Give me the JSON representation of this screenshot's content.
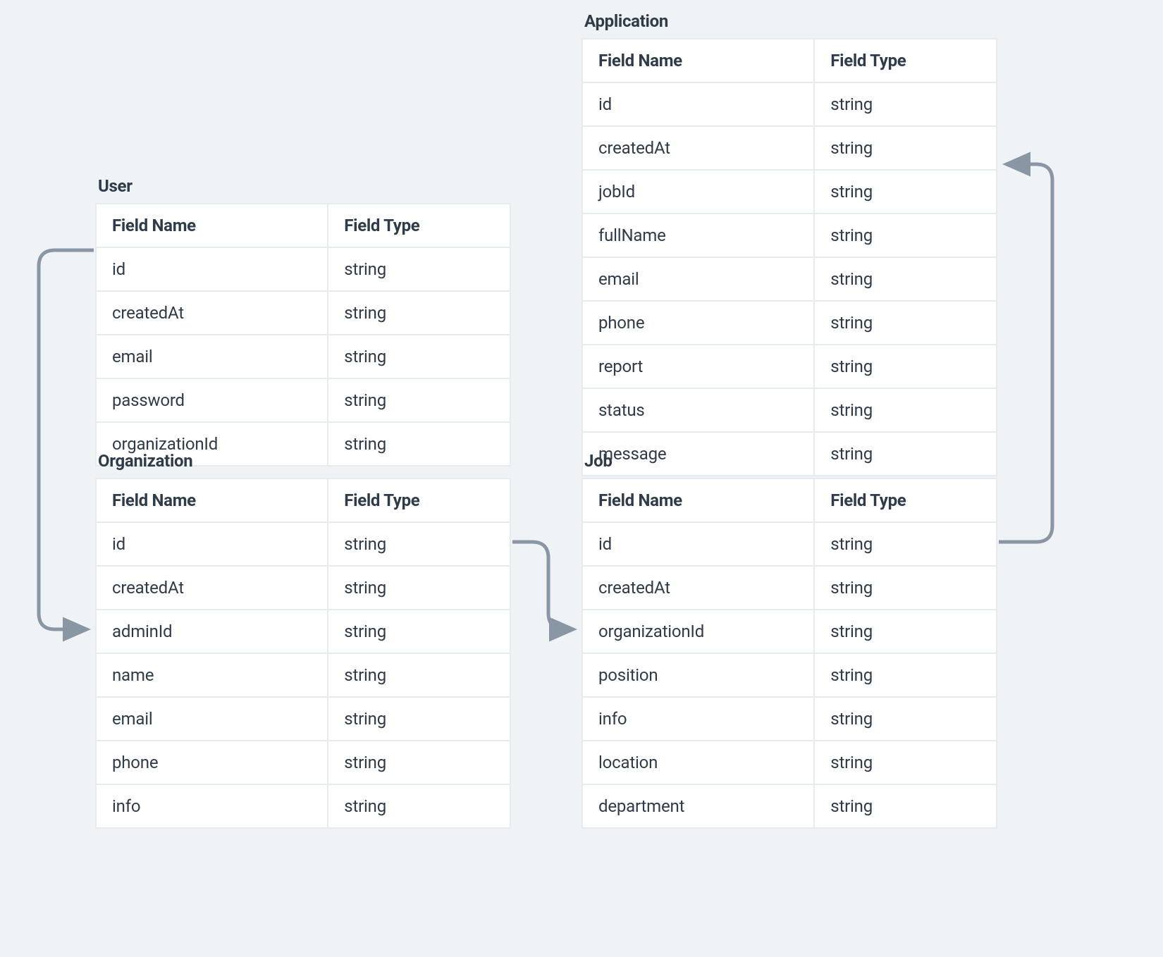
{
  "headers": {
    "name": "Field Name",
    "type": "Field Type"
  },
  "entities": {
    "user": {
      "title": "User",
      "fields": [
        {
          "name": "id",
          "type": "string"
        },
        {
          "name": "createdAt",
          "type": "string"
        },
        {
          "name": "email",
          "type": "string"
        },
        {
          "name": "password",
          "type": "string"
        },
        {
          "name": "organizationId",
          "type": "string"
        }
      ]
    },
    "organization": {
      "title": "Organization",
      "fields": [
        {
          "name": "id",
          "type": "string"
        },
        {
          "name": "createdAt",
          "type": "string"
        },
        {
          "name": "adminId",
          "type": "string"
        },
        {
          "name": "name",
          "type": "string"
        },
        {
          "name": "email",
          "type": "string"
        },
        {
          "name": "phone",
          "type": "string"
        },
        {
          "name": "info",
          "type": "string"
        }
      ]
    },
    "application": {
      "title": "Application",
      "fields": [
        {
          "name": "id",
          "type": "string"
        },
        {
          "name": "createdAt",
          "type": "string"
        },
        {
          "name": "jobId",
          "type": "string"
        },
        {
          "name": "fullName",
          "type": "string"
        },
        {
          "name": "email",
          "type": "string"
        },
        {
          "name": "phone",
          "type": "string"
        },
        {
          "name": "report",
          "type": "string"
        },
        {
          "name": "status",
          "type": "string"
        },
        {
          "name": "message",
          "type": "string"
        }
      ]
    },
    "job": {
      "title": "Job",
      "fields": [
        {
          "name": "id",
          "type": "string"
        },
        {
          "name": "createdAt",
          "type": "string"
        },
        {
          "name": "organizationId",
          "type": "string"
        },
        {
          "name": "position",
          "type": "string"
        },
        {
          "name": "info",
          "type": "string"
        },
        {
          "name": "location",
          "type": "string"
        },
        {
          "name": "department",
          "type": "string"
        }
      ]
    }
  }
}
